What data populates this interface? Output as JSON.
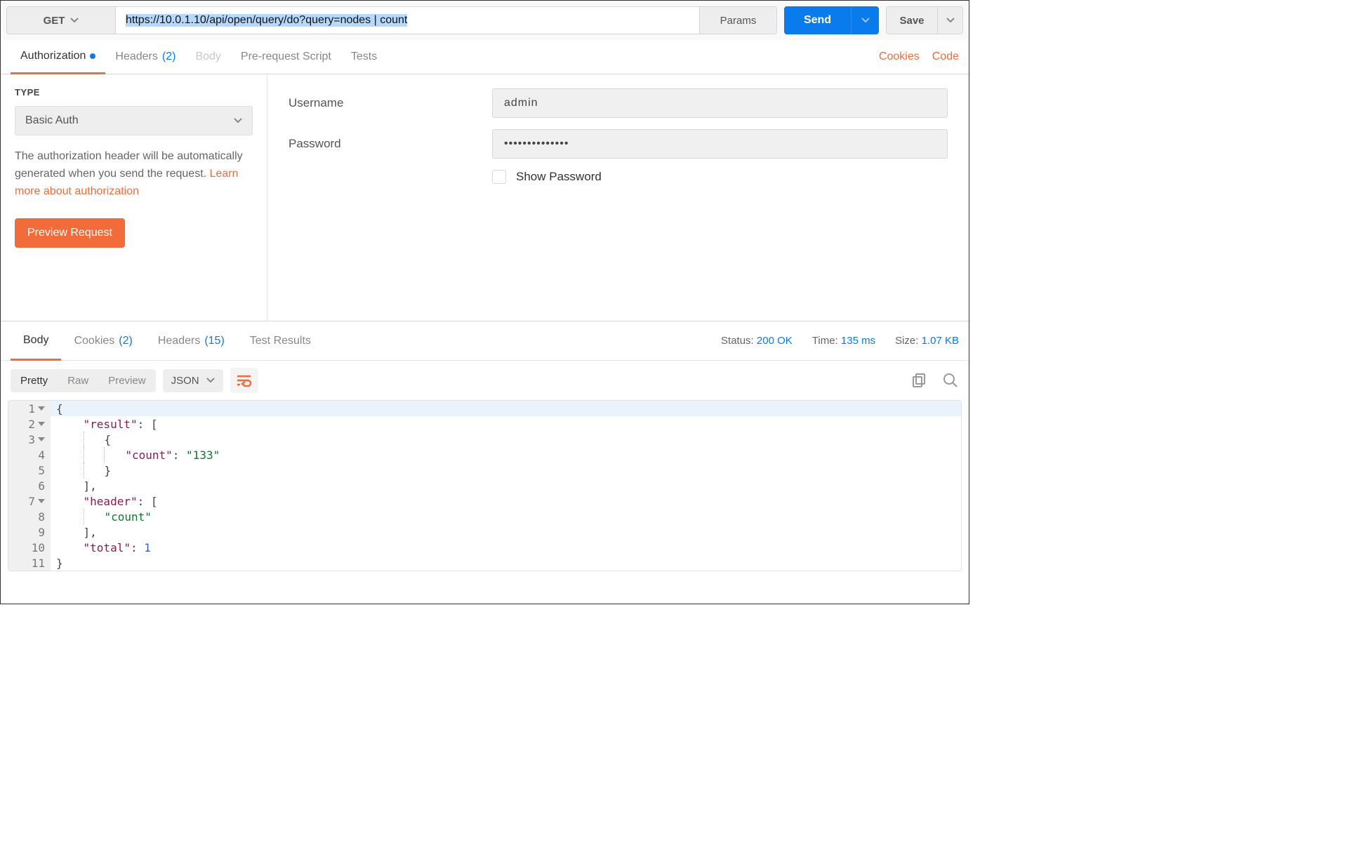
{
  "request": {
    "method": "GET",
    "url": "https://10.0.1.10/api/open/query/do?query=nodes | count",
    "params_label": "Params",
    "send_label": "Send",
    "save_label": "Save"
  },
  "req_tabs": {
    "authorization": "Authorization",
    "headers": "Headers",
    "headers_count": "(2)",
    "body": "Body",
    "prerequest": "Pre-request Script",
    "tests": "Tests",
    "cookies": "Cookies",
    "code": "Code"
  },
  "auth": {
    "type_label": "TYPE",
    "type_value": "Basic Auth",
    "desc_prefix": "The authorization header will be automatically generated when you send the request. ",
    "desc_link": "Learn more about authorization",
    "preview_label": "Preview Request",
    "username_label": "Username",
    "username_value": "admin",
    "password_label": "Password",
    "password_value": "••••••••••••••",
    "show_password_label": "Show Password"
  },
  "resp_tabs": {
    "body": "Body",
    "cookies": "Cookies",
    "cookies_count": "(2)",
    "headers": "Headers",
    "headers_count": "(15)",
    "test_results": "Test Results"
  },
  "resp_meta": {
    "status_label": "Status:",
    "status_value": "200 OK",
    "time_label": "Time:",
    "time_value": "135 ms",
    "size_label": "Size:",
    "size_value": "1.07 KB"
  },
  "body_toolbar": {
    "pretty": "Pretty",
    "raw": "Raw",
    "preview": "Preview",
    "format": "JSON"
  },
  "response_body": {
    "lines": [
      "1",
      "2",
      "3",
      "4",
      "5",
      "6",
      "7",
      "8",
      "9",
      "10",
      "11"
    ],
    "json_text": "{\n    \"result\": [\n        {\n            \"count\": \"133\"\n        }\n    ],\n    \"header\": [\n        \"count\"\n    ],\n    \"total\": 1\n}",
    "tokens": {
      "k_result": "\"result\"",
      "k_count": "\"count\"",
      "v_count": "\"133\"",
      "k_header": "\"header\"",
      "v_header0": "\"count\"",
      "k_total": "\"total\"",
      "v_total": "1"
    }
  }
}
